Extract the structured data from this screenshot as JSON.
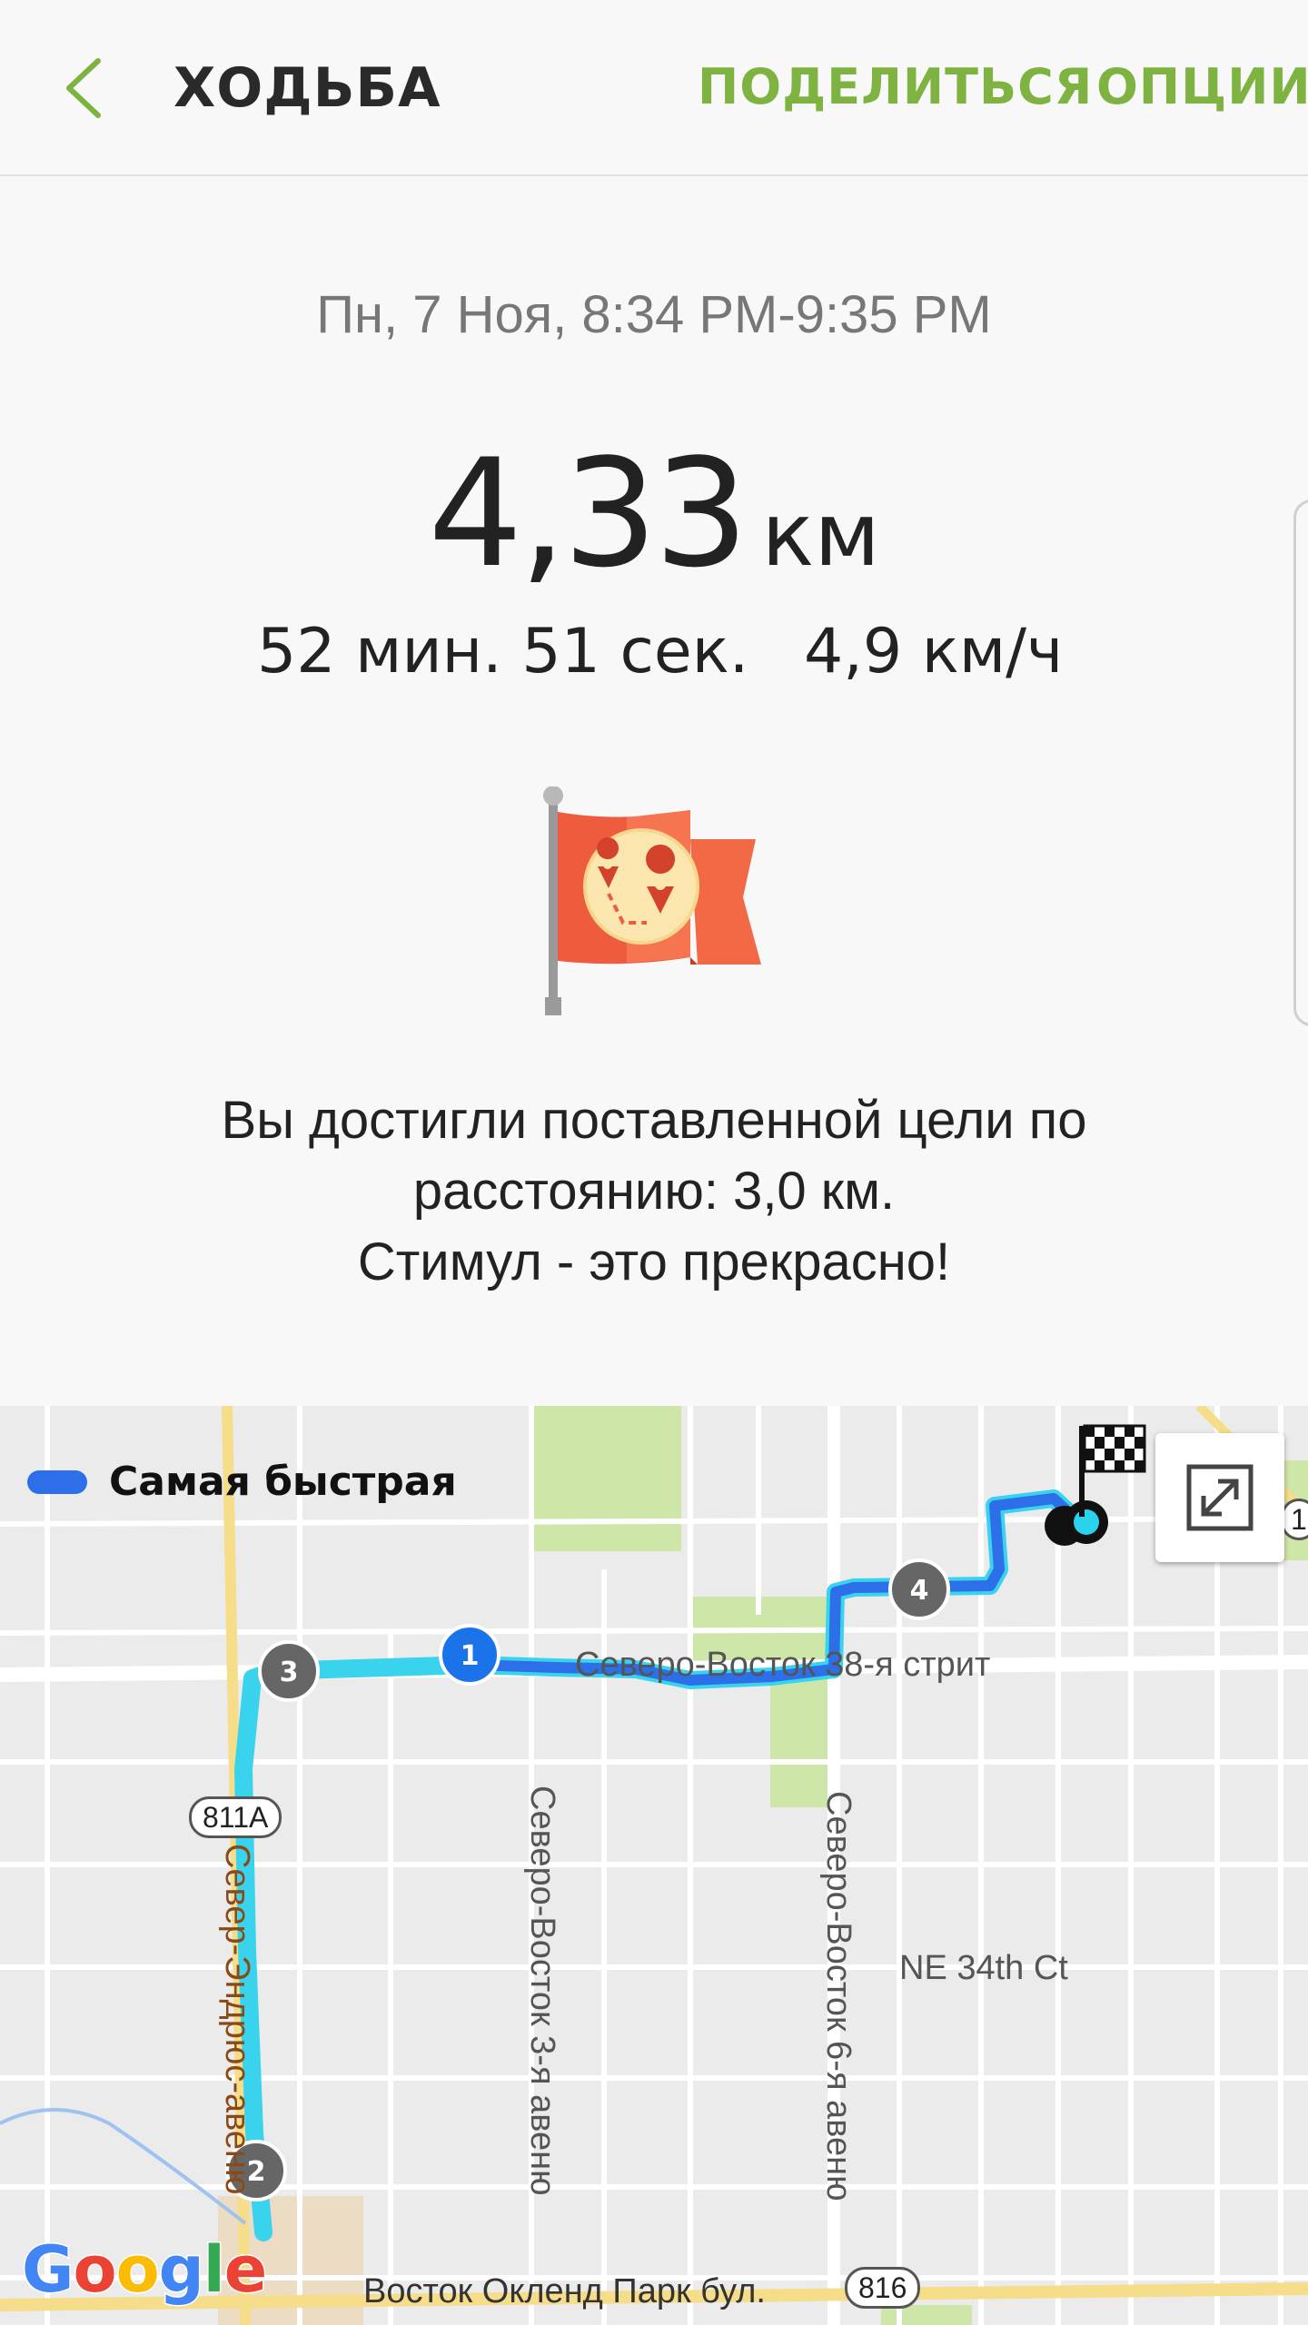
{
  "header": {
    "title": "ХОДЬБА",
    "share_label": "ПОДЕЛИТЬСЯ",
    "options_label": "ОПЦИИ",
    "back_icon": "chevron-left-icon",
    "accent_color": "#7eb342"
  },
  "summary": {
    "date_range": "Пн, 7 Ноя, 8:34 PM-9:35 PM",
    "distance_value": "4,33",
    "distance_unit": "км",
    "duration": "52 мин. 51 сек.",
    "speed": "4,9 км/ч"
  },
  "goal": {
    "icon": "goal-flag-icon",
    "line1": "Вы достигли поставленной цели по",
    "line2": "расстоянию: 3,0 км.",
    "line3": "Стимул - это прекрасно!"
  },
  "map": {
    "legend_label": "Самая быстрая",
    "route_color": "#2c6fe8",
    "expand_icon": "expand-icon",
    "finish_icon": "checkered-flag-icon",
    "markers": [
      "1",
      "2",
      "3",
      "4"
    ],
    "streets": {
      "ne_38th": "Северо-Восток 38-я стрит",
      "ne_34th_ct": "NE 34th Ct",
      "ne_3rd_ave": "Северо-Восток 3-я авеню",
      "ne_6th_ave": "Северо-Восток 6-я авеню",
      "n_andrews": "Север-Эндрюс-авеню",
      "e_oakland": "Восток Окленд Парк бул."
    },
    "shields": {
      "r811a": "811A",
      "r816": "816",
      "r1": "1"
    },
    "attribution": "Google"
  }
}
